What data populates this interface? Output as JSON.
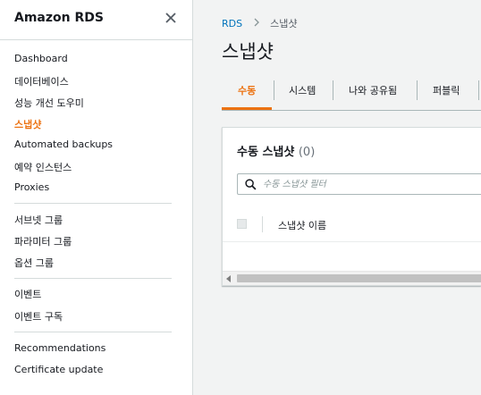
{
  "sidebar": {
    "title": "Amazon RDS",
    "close_icon": "close-icon",
    "items": [
      {
        "label": "Dashboard"
      },
      {
        "label": "데이터베이스"
      },
      {
        "label": "성능 개선 도우미"
      },
      {
        "label": "스냅샷",
        "active": true
      },
      {
        "label": "Automated backups"
      },
      {
        "label": "예약 인스턴스"
      },
      {
        "label": "Proxies"
      },
      {
        "label": "서브넷 그룹"
      },
      {
        "label": "파라미터 그룹"
      },
      {
        "label": "옵션 그룹"
      },
      {
        "label": "이벤트"
      },
      {
        "label": "이벤트 구독"
      },
      {
        "label": "Recommendations"
      },
      {
        "label": "Certificate update"
      }
    ]
  },
  "breadcrumb": {
    "root": "RDS",
    "current": "스냅샷"
  },
  "page": {
    "title": "스냅샷"
  },
  "tabs": [
    {
      "label": "수동",
      "active": true
    },
    {
      "label": "시스템"
    },
    {
      "label": "나와 공유됨"
    },
    {
      "label": "퍼블릭"
    }
  ],
  "panel": {
    "title": "수동 스냅샷",
    "count": "(0)",
    "search_placeholder": "수동 스냅샷 필터",
    "column_header": "스냅샷 이름"
  },
  "colors": {
    "accent": "#ec7211",
    "link": "#0073bb",
    "text": "#16191f"
  }
}
